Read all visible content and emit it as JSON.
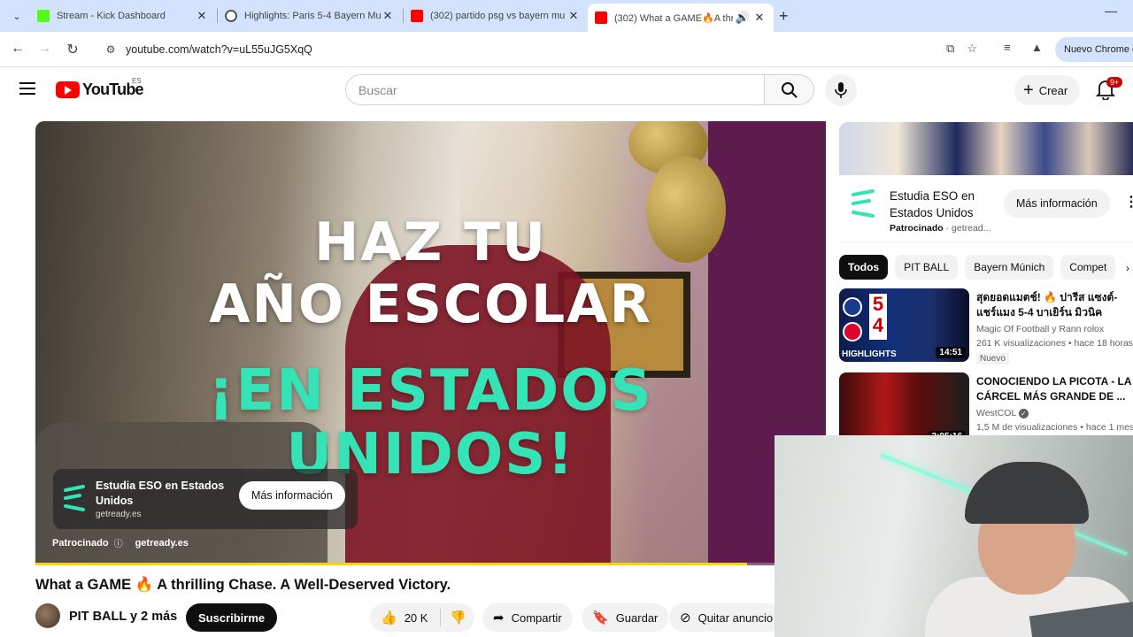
{
  "browser": {
    "tabs": [
      {
        "title": "Stream - Kick Dashboard",
        "favicon_color": "#53fc18"
      },
      {
        "title": "Highlights: Paris 5-4 Bayern Mu",
        "favicon_color": "#555555"
      },
      {
        "title": "(302) partido psg vs bayern mu",
        "favicon_color": "#ff0000"
      },
      {
        "title": "(302) What a GAME🔥A thr",
        "favicon_color": "#ff0000"
      }
    ],
    "url": "youtube.com/watch?v=uL55uJG5XqQ",
    "profile_label": "Nuevo Chrome c"
  },
  "header": {
    "logo_text": "YouTube",
    "region": "ES",
    "search_placeholder": "Buscar",
    "create_label": "Crear",
    "notifications_badge": "9+"
  },
  "player": {
    "headline_line1": "HAZ TU",
    "headline_line2": "AÑO ESCOLAR",
    "headline_line3": "¡EN ESTADOS",
    "headline_line4": "UNIDOS!",
    "ad_title": "Estudia ESO en Estados Unidos",
    "ad_domain": "getready.es",
    "ad_cta": "Más información",
    "sponsored_label": "Patrocinado",
    "sponsor_domain": "getready.es",
    "progress_fraction": 0.9
  },
  "video": {
    "title": "What a GAME 🔥 A thrilling Chase. A Well-Deserved Victory.",
    "channel": "PIT BALL y 2 más",
    "subscribe_label": "Suscribirme",
    "likes": "20 K",
    "share_label": "Compartir",
    "save_label": "Guardar",
    "remove_ads_label": "Quitar anuncio"
  },
  "sidebar": {
    "sponsor": {
      "title": "Estudia ESO en Estados Unidos",
      "sponsored": "Patrocinado",
      "domain": "getread...",
      "cta": "Más información"
    },
    "chips": [
      "Todos",
      "PIT BALL",
      "Bayern Múnich",
      "Compet"
    ],
    "recommendations": [
      {
        "title": "สุดยอดแมตช์! 🔥 ปารีส แซงต์-แชร์แมง 5-4 บาเยิร์น มิวนิค",
        "channel": "Magic Of Football y Rann rolox",
        "meta": "261 K visualizaciones • hace 18 horas",
        "badge": "Nuevo",
        "duration": "14:51",
        "thumb_label": "HIGHLIGHTS"
      },
      {
        "title": "CONOCIENDO LA PICOTA - LA CÁRCEL MÁS GRANDE DE ...",
        "channel": "WestCOL",
        "meta": "1,5 M de visualizaciones • hace 1 mes",
        "duration": "2:05:16"
      }
    ]
  }
}
